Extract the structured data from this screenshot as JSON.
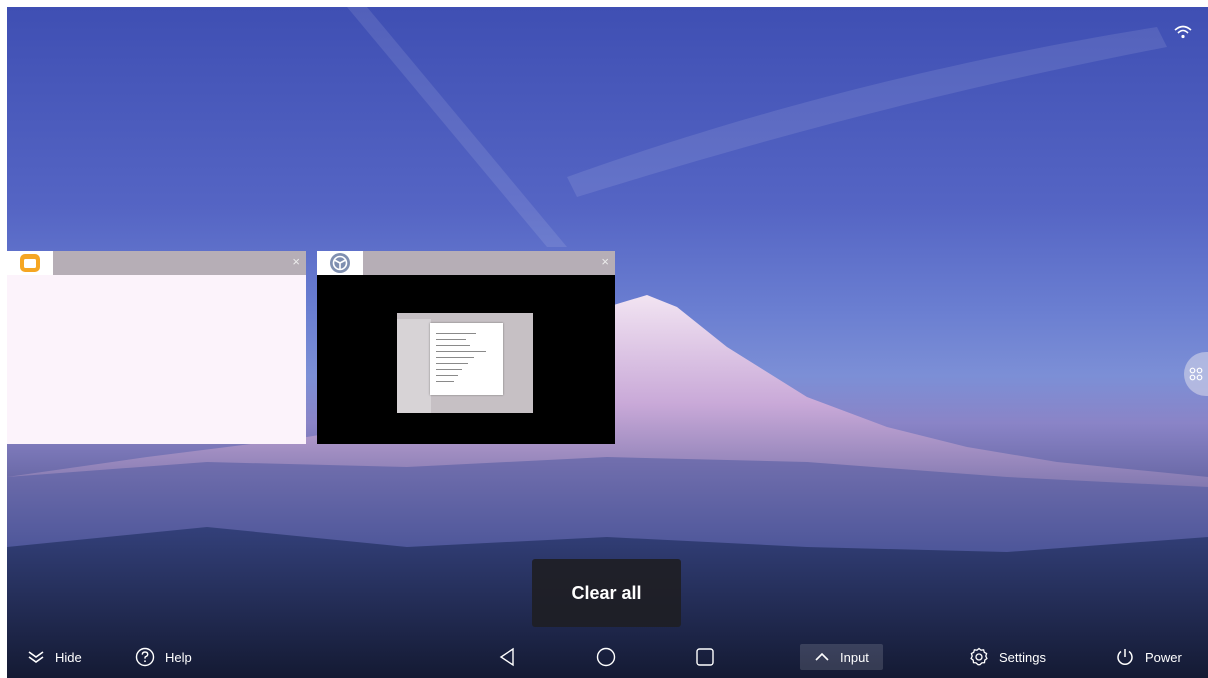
{
  "tasks": [
    {
      "app_icon": "folder-icon",
      "close": "×"
    },
    {
      "app_icon": "steering-wheel-icon",
      "close": "×"
    }
  ],
  "clear_all_label": "Clear all",
  "navbar": {
    "hide_label": "Hide",
    "help_label": "Help",
    "input_label": "Input",
    "settings_label": "Settings",
    "power_label": "Power"
  },
  "colors": {
    "folder_accent": "#f5a623",
    "card_titlebar": "#b6aeb6",
    "card_light_body": "#fcf3fb"
  }
}
